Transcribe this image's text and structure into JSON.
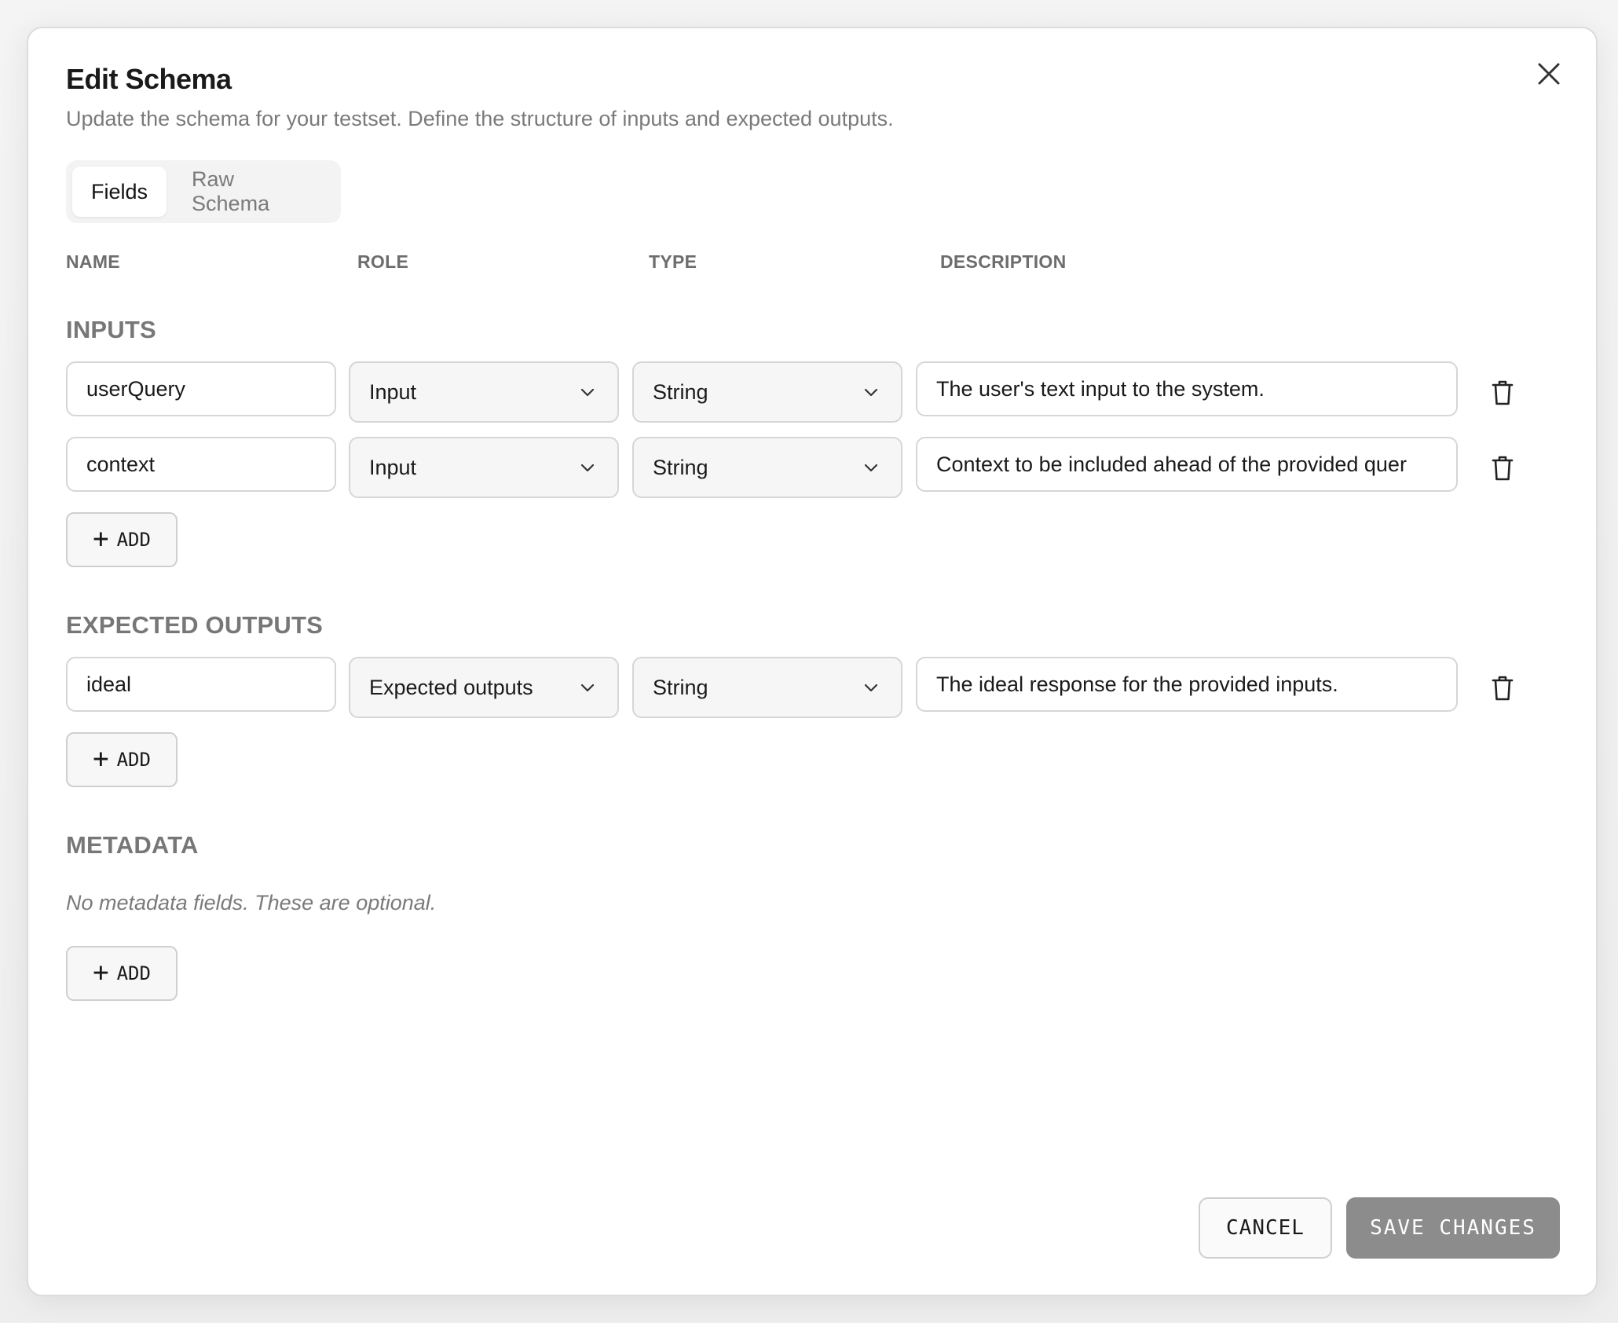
{
  "dialog": {
    "title": "Edit Schema",
    "subtitle": "Update the schema for your testset. Define the structure of inputs and expected outputs."
  },
  "tabs": [
    {
      "label": "Fields",
      "active": true
    },
    {
      "label": "Raw Schema",
      "active": false
    }
  ],
  "columns": {
    "name": "NAME",
    "role": "ROLE",
    "type": "TYPE",
    "description": "DESCRIPTION"
  },
  "sections": {
    "inputs": {
      "title": "INPUTS",
      "rows": [
        {
          "name": "userQuery",
          "role": "Input",
          "type": "String",
          "description": "The user's text input to the system."
        },
        {
          "name": "context",
          "role": "Input",
          "type": "String",
          "description": "Context to be included ahead of the provided quer"
        }
      ],
      "add_label": "ADD"
    },
    "expected_outputs": {
      "title": "EXPECTED OUTPUTS",
      "rows": [
        {
          "name": "ideal",
          "role": "Expected outputs",
          "type": "String",
          "description": "The ideal response for the provided inputs."
        }
      ],
      "add_label": "ADD"
    },
    "metadata": {
      "title": "METADATA",
      "empty_text": "No metadata fields. These are optional.",
      "add_label": "ADD"
    }
  },
  "actions": {
    "cancel": "CANCEL",
    "save": "SAVE CHANGES"
  },
  "colors": {
    "save_button_bg": "#8c8c8c",
    "border": "#d6d6d6",
    "muted_text": "#7a7a7a"
  }
}
